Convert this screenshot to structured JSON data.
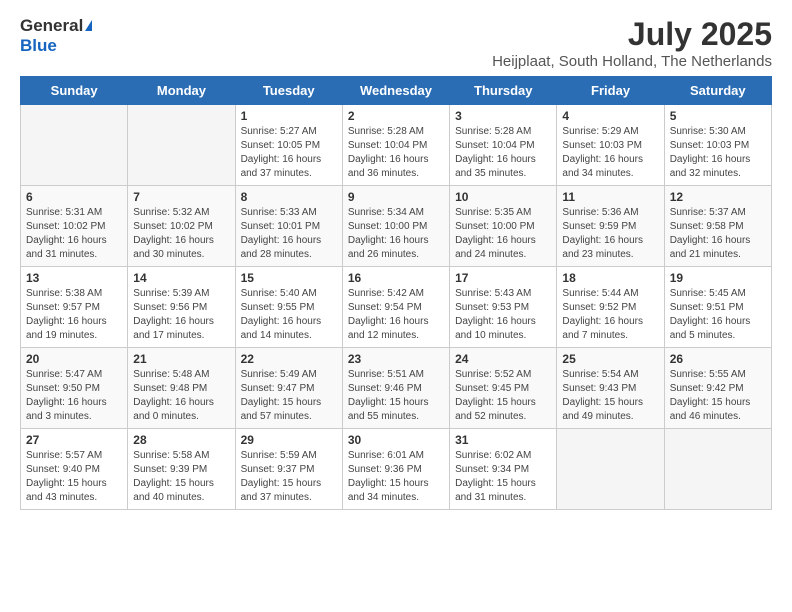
{
  "header": {
    "logo_general": "General",
    "logo_blue": "Blue",
    "title": "July 2025",
    "subtitle": "Heijplaat, South Holland, The Netherlands"
  },
  "weekdays": [
    "Sunday",
    "Monday",
    "Tuesday",
    "Wednesday",
    "Thursday",
    "Friday",
    "Saturday"
  ],
  "weeks": [
    [
      {
        "day": "",
        "info": ""
      },
      {
        "day": "",
        "info": ""
      },
      {
        "day": "1",
        "info": "Sunrise: 5:27 AM\nSunset: 10:05 PM\nDaylight: 16 hours\nand 37 minutes."
      },
      {
        "day": "2",
        "info": "Sunrise: 5:28 AM\nSunset: 10:04 PM\nDaylight: 16 hours\nand 36 minutes."
      },
      {
        "day": "3",
        "info": "Sunrise: 5:28 AM\nSunset: 10:04 PM\nDaylight: 16 hours\nand 35 minutes."
      },
      {
        "day": "4",
        "info": "Sunrise: 5:29 AM\nSunset: 10:03 PM\nDaylight: 16 hours\nand 34 minutes."
      },
      {
        "day": "5",
        "info": "Sunrise: 5:30 AM\nSunset: 10:03 PM\nDaylight: 16 hours\nand 32 minutes."
      }
    ],
    [
      {
        "day": "6",
        "info": "Sunrise: 5:31 AM\nSunset: 10:02 PM\nDaylight: 16 hours\nand 31 minutes."
      },
      {
        "day": "7",
        "info": "Sunrise: 5:32 AM\nSunset: 10:02 PM\nDaylight: 16 hours\nand 30 minutes."
      },
      {
        "day": "8",
        "info": "Sunrise: 5:33 AM\nSunset: 10:01 PM\nDaylight: 16 hours\nand 28 minutes."
      },
      {
        "day": "9",
        "info": "Sunrise: 5:34 AM\nSunset: 10:00 PM\nDaylight: 16 hours\nand 26 minutes."
      },
      {
        "day": "10",
        "info": "Sunrise: 5:35 AM\nSunset: 10:00 PM\nDaylight: 16 hours\nand 24 minutes."
      },
      {
        "day": "11",
        "info": "Sunrise: 5:36 AM\nSunset: 9:59 PM\nDaylight: 16 hours\nand 23 minutes."
      },
      {
        "day": "12",
        "info": "Sunrise: 5:37 AM\nSunset: 9:58 PM\nDaylight: 16 hours\nand 21 minutes."
      }
    ],
    [
      {
        "day": "13",
        "info": "Sunrise: 5:38 AM\nSunset: 9:57 PM\nDaylight: 16 hours\nand 19 minutes."
      },
      {
        "day": "14",
        "info": "Sunrise: 5:39 AM\nSunset: 9:56 PM\nDaylight: 16 hours\nand 17 minutes."
      },
      {
        "day": "15",
        "info": "Sunrise: 5:40 AM\nSunset: 9:55 PM\nDaylight: 16 hours\nand 14 minutes."
      },
      {
        "day": "16",
        "info": "Sunrise: 5:42 AM\nSunset: 9:54 PM\nDaylight: 16 hours\nand 12 minutes."
      },
      {
        "day": "17",
        "info": "Sunrise: 5:43 AM\nSunset: 9:53 PM\nDaylight: 16 hours\nand 10 minutes."
      },
      {
        "day": "18",
        "info": "Sunrise: 5:44 AM\nSunset: 9:52 PM\nDaylight: 16 hours\nand 7 minutes."
      },
      {
        "day": "19",
        "info": "Sunrise: 5:45 AM\nSunset: 9:51 PM\nDaylight: 16 hours\nand 5 minutes."
      }
    ],
    [
      {
        "day": "20",
        "info": "Sunrise: 5:47 AM\nSunset: 9:50 PM\nDaylight: 16 hours\nand 3 minutes."
      },
      {
        "day": "21",
        "info": "Sunrise: 5:48 AM\nSunset: 9:48 PM\nDaylight: 16 hours\nand 0 minutes."
      },
      {
        "day": "22",
        "info": "Sunrise: 5:49 AM\nSunset: 9:47 PM\nDaylight: 15 hours\nand 57 minutes."
      },
      {
        "day": "23",
        "info": "Sunrise: 5:51 AM\nSunset: 9:46 PM\nDaylight: 15 hours\nand 55 minutes."
      },
      {
        "day": "24",
        "info": "Sunrise: 5:52 AM\nSunset: 9:45 PM\nDaylight: 15 hours\nand 52 minutes."
      },
      {
        "day": "25",
        "info": "Sunrise: 5:54 AM\nSunset: 9:43 PM\nDaylight: 15 hours\nand 49 minutes."
      },
      {
        "day": "26",
        "info": "Sunrise: 5:55 AM\nSunset: 9:42 PM\nDaylight: 15 hours\nand 46 minutes."
      }
    ],
    [
      {
        "day": "27",
        "info": "Sunrise: 5:57 AM\nSunset: 9:40 PM\nDaylight: 15 hours\nand 43 minutes."
      },
      {
        "day": "28",
        "info": "Sunrise: 5:58 AM\nSunset: 9:39 PM\nDaylight: 15 hours\nand 40 minutes."
      },
      {
        "day": "29",
        "info": "Sunrise: 5:59 AM\nSunset: 9:37 PM\nDaylight: 15 hours\nand 37 minutes."
      },
      {
        "day": "30",
        "info": "Sunrise: 6:01 AM\nSunset: 9:36 PM\nDaylight: 15 hours\nand 34 minutes."
      },
      {
        "day": "31",
        "info": "Sunrise: 6:02 AM\nSunset: 9:34 PM\nDaylight: 15 hours\nand 31 minutes."
      },
      {
        "day": "",
        "info": ""
      },
      {
        "day": "",
        "info": ""
      }
    ]
  ]
}
